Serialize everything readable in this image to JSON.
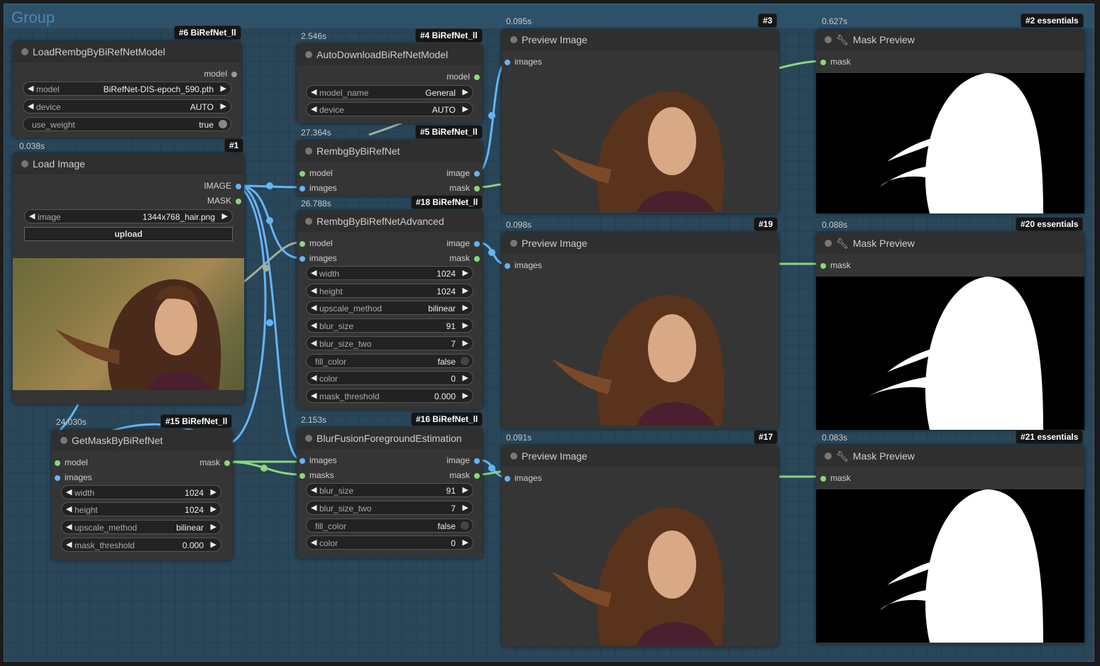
{
  "group": {
    "title": "Group"
  },
  "colors": {
    "image_link": "#64b5f6",
    "mask_link": "#8bd77b",
    "model_link": "#9fb0a0",
    "group_bg": "#2a4659"
  },
  "nodes": {
    "load_model": {
      "badge": "#6 BiRefNet_ll",
      "title": "LoadRembgByBiRefNetModel",
      "outputs": [
        "model"
      ],
      "widgets": [
        {
          "label": "model",
          "value": "BiRefNet-DIS-epoch_590.pth"
        },
        {
          "label": "device",
          "value": "AUTO"
        }
      ],
      "toggle": {
        "label": "use_weight",
        "value": "true"
      },
      "footer_badge": "#1"
    },
    "load_image": {
      "time": "0.038s",
      "title": "Load Image",
      "outputs": [
        "IMAGE",
        "MASK"
      ],
      "widget": {
        "label": "image",
        "value": "1344x768_hair.png"
      },
      "button": "upload"
    },
    "auto_download": {
      "time": "2.546s",
      "badge": "#4 BiRefNet_ll",
      "title": "AutoDownloadBiRefNetModel",
      "outputs": [
        "model"
      ],
      "widgets": [
        {
          "label": "model_name",
          "value": "General"
        },
        {
          "label": "device",
          "value": "AUTO"
        }
      ]
    },
    "rembg": {
      "time": "27.364s",
      "badge": "#5 BiRefNet_ll",
      "title": "RembgByBiRefNet",
      "inputs": [
        "model",
        "images"
      ],
      "outputs": [
        "image",
        "mask"
      ]
    },
    "rembg_adv": {
      "time": "26.788s",
      "badge": "#18 BiRefNet_ll",
      "title": "RembgByBiRefNetAdvanced",
      "inputs": [
        "model",
        "images"
      ],
      "outputs": [
        "image",
        "mask"
      ],
      "widgets": [
        {
          "label": "width",
          "value": "1024"
        },
        {
          "label": "height",
          "value": "1024"
        },
        {
          "label": "upscale_method",
          "value": "bilinear"
        },
        {
          "label": "blur_size",
          "value": "91"
        },
        {
          "label": "blur_size_two",
          "value": "7"
        }
      ],
      "toggle": {
        "label": "fill_color",
        "value": "false"
      },
      "widgets2": [
        {
          "label": "color",
          "value": "0"
        },
        {
          "label": "mask_threshold",
          "value": "0.000"
        }
      ]
    },
    "get_mask": {
      "time": "24.030s",
      "badge": "#15 BiRefNet_ll",
      "title": "GetMaskByBiRefNet",
      "inputs": [
        "model",
        "images"
      ],
      "outputs": [
        "mask"
      ],
      "widgets": [
        {
          "label": "width",
          "value": "1024"
        },
        {
          "label": "height",
          "value": "1024"
        },
        {
          "label": "upscale_method",
          "value": "bilinear"
        },
        {
          "label": "mask_threshold",
          "value": "0.000"
        }
      ]
    },
    "blur_fusion": {
      "time": "2.153s",
      "badge": "#16 BiRefNet_ll",
      "title": "BlurFusionForegroundEstimation",
      "inputs": [
        "images",
        "masks"
      ],
      "outputs": [
        "image",
        "mask"
      ],
      "widgets": [
        {
          "label": "blur_size",
          "value": "91"
        },
        {
          "label": "blur_size_two",
          "value": "7"
        }
      ],
      "toggle": {
        "label": "fill_color",
        "value": "false"
      },
      "widgets2": [
        {
          "label": "color",
          "value": "0"
        }
      ]
    },
    "preview1": {
      "time": "0.095s",
      "badge": "#3",
      "title": "Preview Image",
      "input": "images"
    },
    "preview2": {
      "time": "0.098s",
      "badge": "#19",
      "title": "Preview Image",
      "input": "images"
    },
    "preview3": {
      "time": "0.091s",
      "badge": "#17",
      "title": "Preview Image",
      "input": "images"
    },
    "mask1": {
      "time": "0.627s",
      "badge": "#2 essentials",
      "title": "Mask Preview",
      "input": "mask"
    },
    "mask2": {
      "time": "0.088s",
      "badge": "#20 essentials",
      "title": "Mask Preview",
      "input": "mask"
    },
    "mask3": {
      "time": "0.083s",
      "badge": "#21 essentials",
      "title": "Mask Preview",
      "input": "mask"
    }
  }
}
